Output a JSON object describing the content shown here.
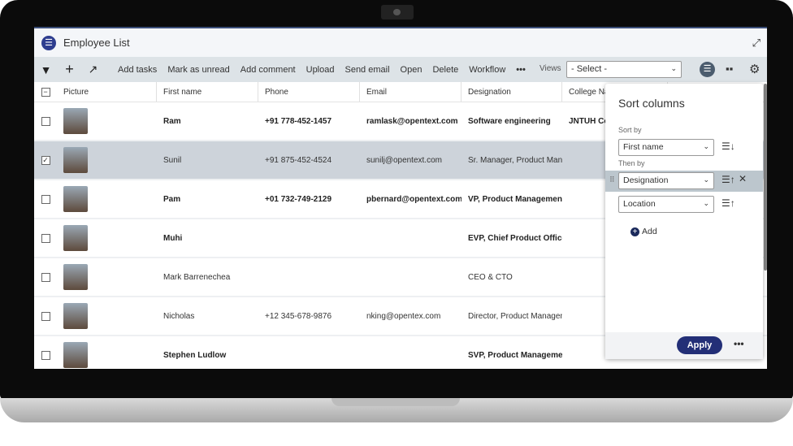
{
  "app": {
    "title": "Employee List",
    "accent": "#232f77"
  },
  "toolbar": {
    "items": [
      "Add tasks",
      "Mark as unread",
      "Add comment",
      "Upload",
      "Send email",
      "Open",
      "Delete",
      "Workflow"
    ],
    "more": "•••",
    "views_label": "Views",
    "views_value": "- Select -"
  },
  "table": {
    "columns": [
      "Picture",
      "First name",
      "Phone",
      "Email",
      "Designation",
      "College Name"
    ],
    "rows": [
      {
        "first": "Ram",
        "phone": "+91 778-452-1457",
        "email": "ramlask@opentext.com",
        "designation": "Software engineering",
        "college": "JNTUH College",
        "bold": true,
        "selected": false
      },
      {
        "first": "Sunil",
        "phone": "+91 875-452-4524",
        "email": "sunilj@opentext.com",
        "designation": "Sr. Manager, Product Manag...",
        "college": "",
        "bold": false,
        "selected": true
      },
      {
        "first": "Pam",
        "phone": "+01 732-749-2129",
        "email": "pbernard@opentext.com",
        "designation": "VP, Product Management",
        "college": "",
        "bold": true,
        "selected": false
      },
      {
        "first": "Muhi",
        "phone": "",
        "email": "",
        "designation": "EVP, Chief Product Officer",
        "college": "",
        "bold": true,
        "selected": false
      },
      {
        "first": "Mark Barrenechea",
        "phone": "",
        "email": "",
        "designation": "CEO & CTO",
        "college": "",
        "bold": false,
        "selected": false
      },
      {
        "first": "Nicholas",
        "phone": "+12 345-678-9876",
        "email": "nking@opentex.com",
        "designation": "Director, Product Managem...",
        "college": "",
        "bold": false,
        "selected": false
      },
      {
        "first": "Stephen Ludlow",
        "phone": "",
        "email": "",
        "designation": "SVP, Product Management",
        "college": "",
        "bold": true,
        "selected": false
      }
    ]
  },
  "sort_panel": {
    "title": "Sort columns",
    "sort_by_label": "Sort by",
    "then_by_label": "Then by",
    "sort_by": "First name",
    "then_by": [
      "Designation",
      "Location"
    ],
    "add_label": "Add",
    "apply_label": "Apply",
    "more": "•••"
  }
}
